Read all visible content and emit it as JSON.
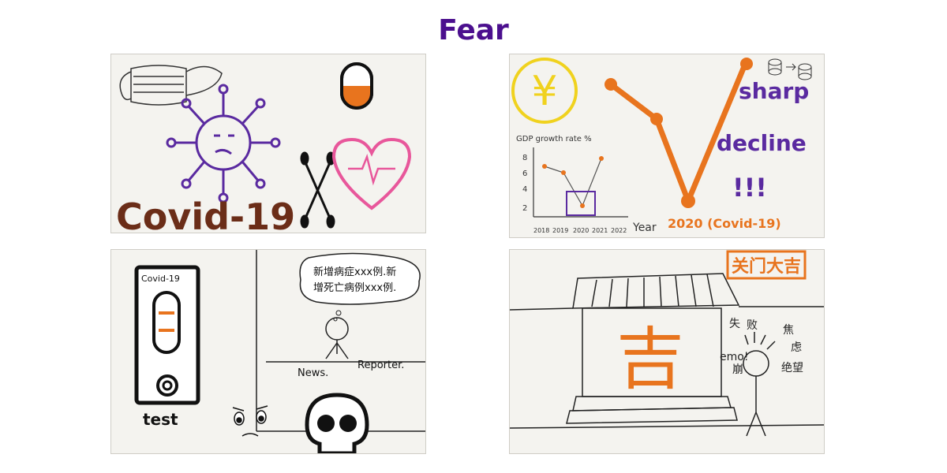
{
  "title": "Fear",
  "colors": {
    "title": "#4b0f8e",
    "purple": "#5a2aa0",
    "orange": "#e8741e",
    "brown": "#6b2d18",
    "pink": "#e8579b",
    "yellow": "#f0d21e",
    "ink": "#1a1a1a"
  },
  "panels": {
    "covid": {
      "label": "Covid-19",
      "icons": [
        "mask-icon",
        "virus-icon",
        "pill-icon",
        "cotton-swabs-icon",
        "heart-ekg-icon"
      ]
    },
    "economy": {
      "yuan_symbol": "¥",
      "graph_label": "GDP growth rate %",
      "y_ticks": [
        "8",
        "6",
        "4",
        "2"
      ],
      "x_ticks": [
        "2018",
        "2019",
        "2020",
        "2021",
        "2022"
      ],
      "x_label": "Year",
      "annotation_1": "sharp",
      "annotation_2": "decline",
      "annotation_3": "!!!",
      "year_note": "2020 (Covid-19)"
    },
    "news": {
      "test_kit_label": "Covid-19",
      "test_label": "test",
      "speech_line_1": "新增病症xxx例.新",
      "speech_line_2": "增死亡病例xxx例.",
      "desk_label_1": "News.",
      "desk_label_2": "Reporter."
    },
    "closing": {
      "sign": "关门大吉",
      "door_character": "吉",
      "emotion_1": "emo!",
      "emotion_2": "失",
      "emotion_3": "败",
      "emotion_4": "焦",
      "emotion_5": "虑",
      "emotion_6": "崩",
      "emotion_7": "绝望"
    }
  }
}
